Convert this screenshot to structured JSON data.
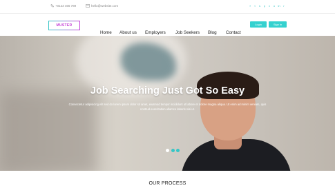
{
  "topbar": {
    "phone": "+0123 456 789",
    "email": "hello@website.com",
    "socials": [
      {
        "icon": "facebook-icon",
        "glyph": "f"
      },
      {
        "icon": "twitter-icon",
        "glyph": "t"
      },
      {
        "icon": "skype-icon",
        "glyph": "s"
      },
      {
        "icon": "pinterest-icon",
        "glyph": "p"
      },
      {
        "icon": "vine-icon",
        "glyph": "v"
      },
      {
        "icon": "instagram-icon",
        "glyph": "o"
      },
      {
        "icon": "linkedin-icon",
        "glyph": "in"
      },
      {
        "icon": "rss-icon",
        "glyph": "r"
      }
    ]
  },
  "nav": {
    "logo": "MUSTER",
    "items": [
      "Home",
      "About us",
      "Employers",
      "Job Seekers",
      "Blog",
      "Contact"
    ],
    "login": "Login",
    "signup": "Sign in"
  },
  "hero": {
    "title": "Job Searching Just Got So Easy",
    "text": "Consectetur adipisicing elit sed do lorem ipsum dolor sit amet, eiusmod tempor incididunt ut labore et dolore magna aliqua. Ut enim ad minim veniam, quis nostrud exercitation ullamco laboris nisi ut.",
    "slides": 3,
    "active_slide": 1
  },
  "process": {
    "heading": "OUR PROCESS"
  },
  "colors": {
    "accent": "#35c6c6",
    "logo": "#c43fd6"
  }
}
